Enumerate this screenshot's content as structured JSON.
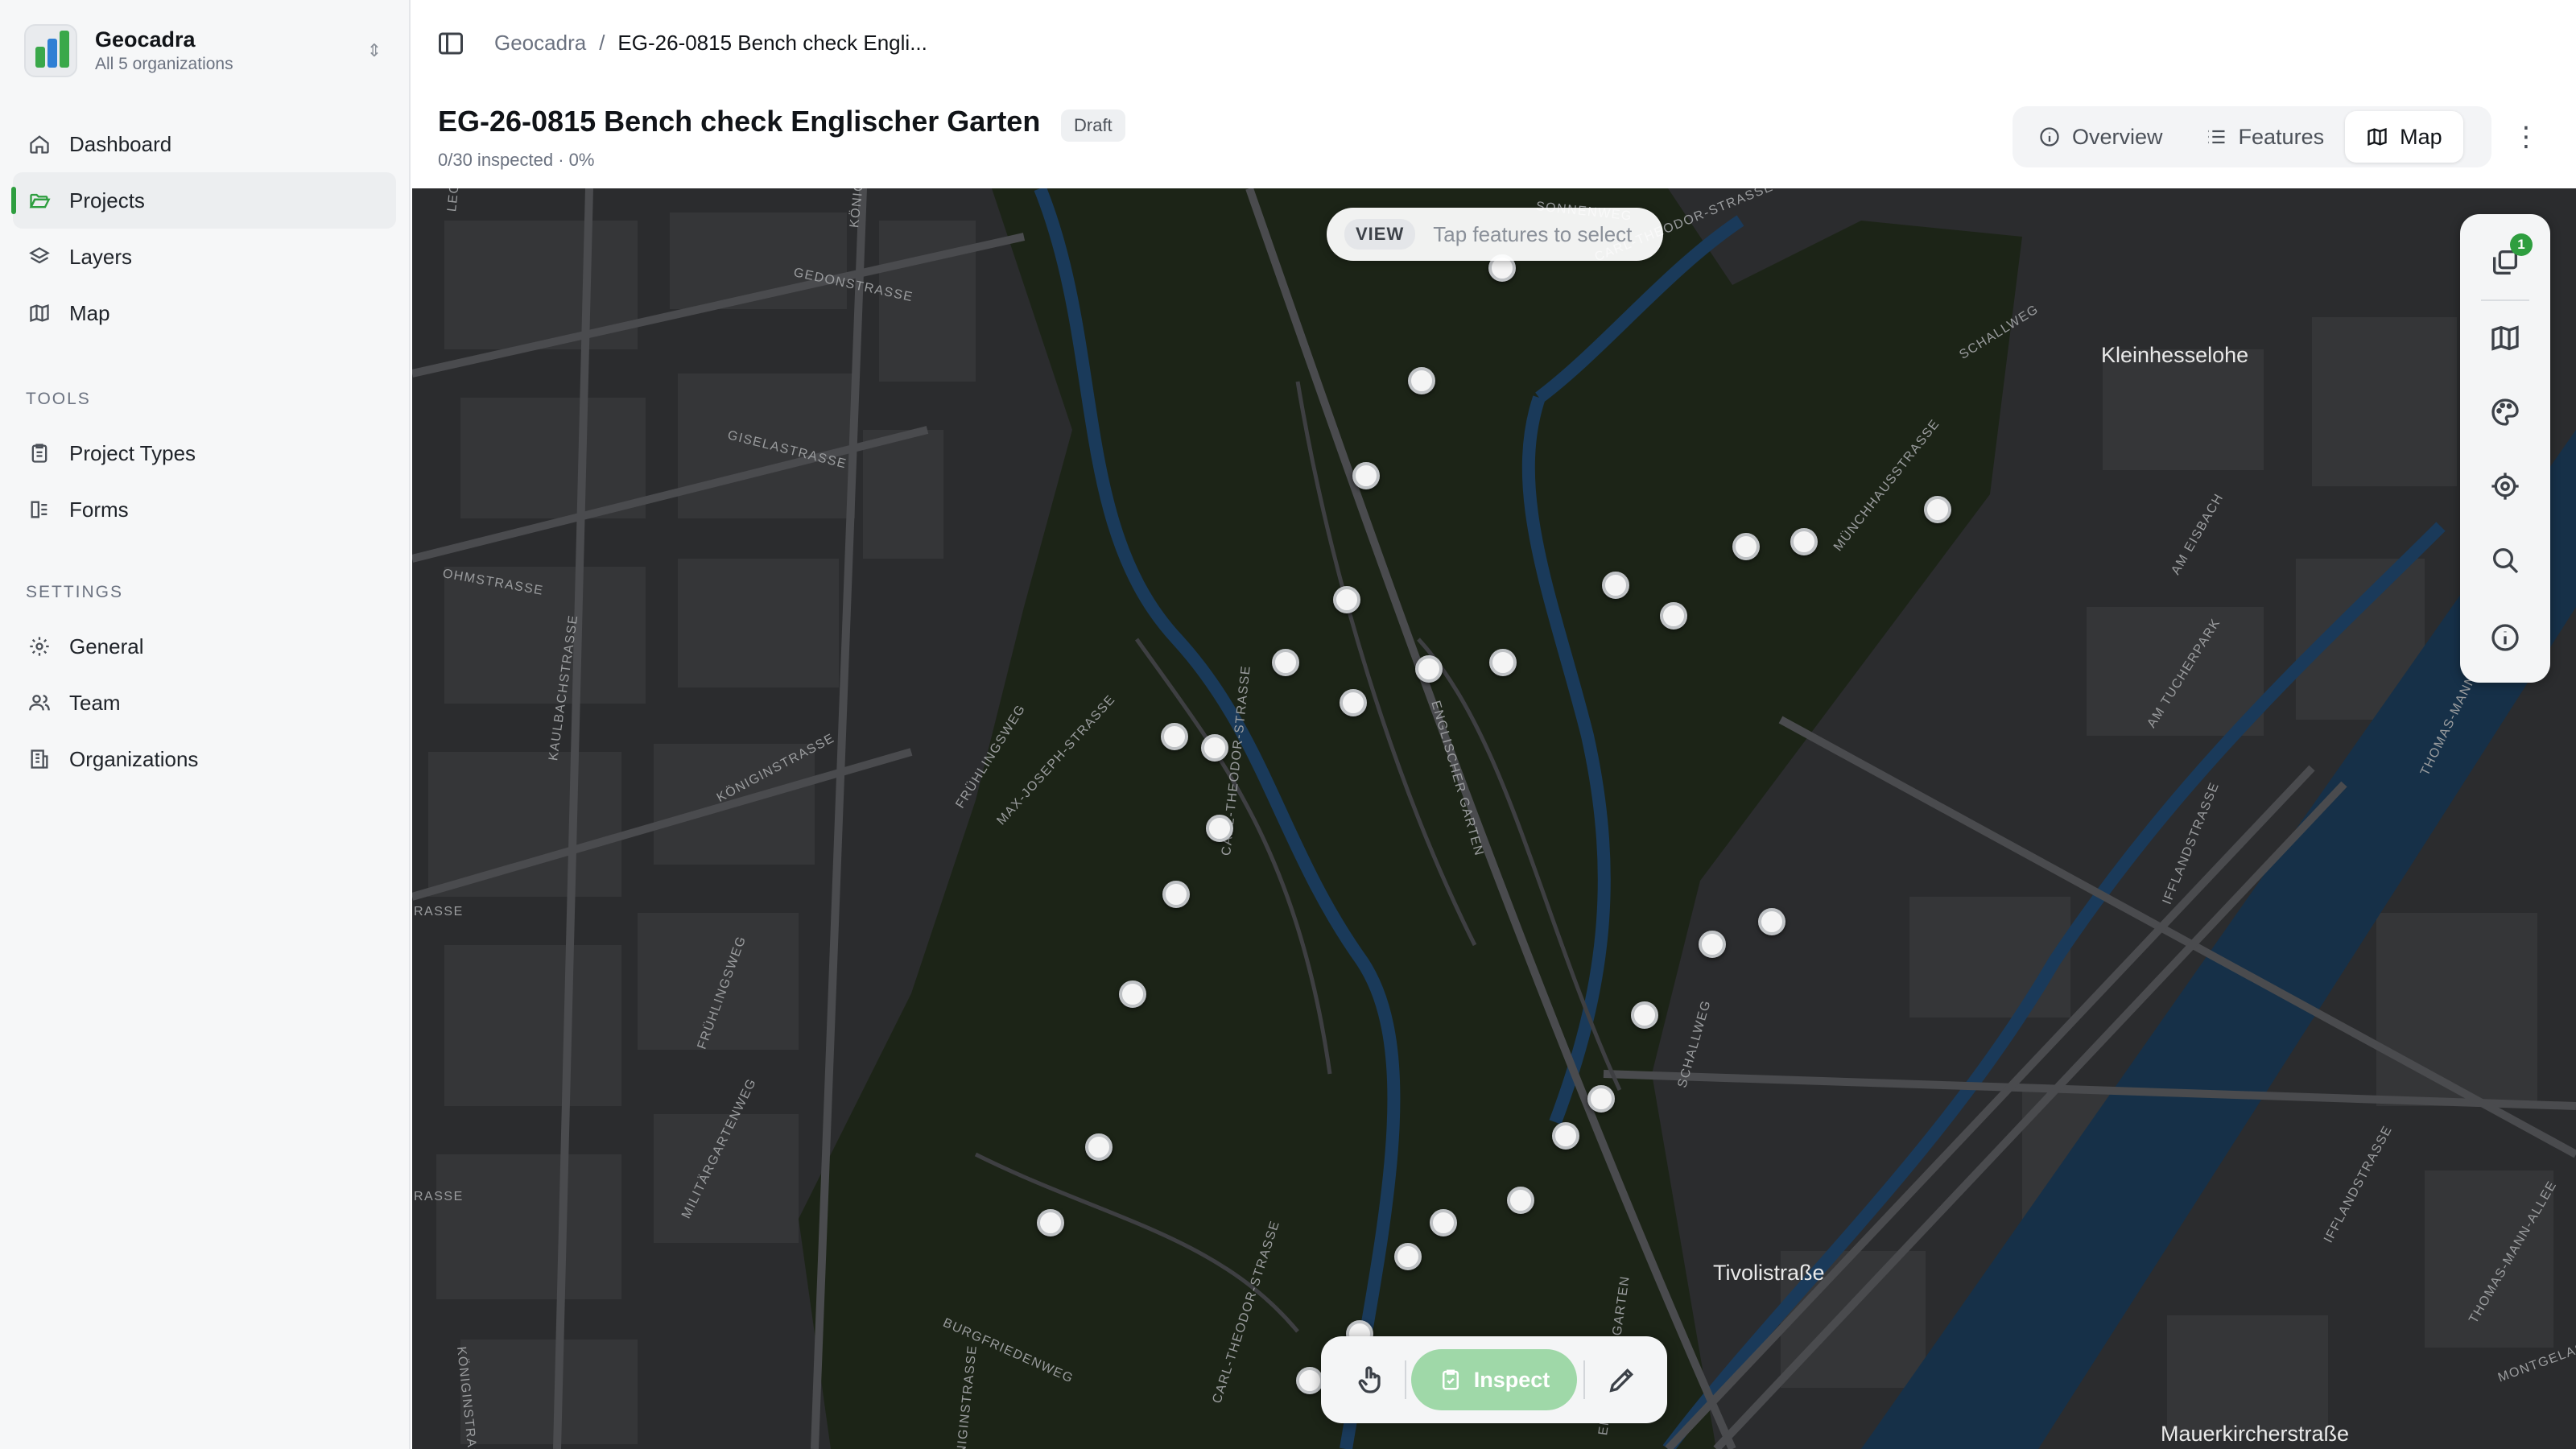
{
  "org": {
    "name": "Geocadra",
    "subtitle": "All 5 organizations"
  },
  "nav": {
    "main": [
      {
        "label": "Dashboard",
        "icon": "home-icon"
      },
      {
        "label": "Projects",
        "icon": "folder-icon",
        "active": true
      },
      {
        "label": "Layers",
        "icon": "layers-icon"
      },
      {
        "label": "Map",
        "icon": "map-icon"
      }
    ],
    "tools_heading": "TOOLS",
    "tools": [
      {
        "label": "Project Types",
        "icon": "clipboard-icon"
      },
      {
        "label": "Forms",
        "icon": "form-icon"
      }
    ],
    "settings_heading": "SETTINGS",
    "settings": [
      {
        "label": "General",
        "icon": "gear-icon"
      },
      {
        "label": "Team",
        "icon": "users-icon"
      },
      {
        "label": "Organizations",
        "icon": "building-icon"
      }
    ]
  },
  "breadcrumb": {
    "root": "Geocadra",
    "separator": "/",
    "current": "EG-26-0815 Bench check Engli..."
  },
  "project": {
    "title": "EG-26-0815 Bench check Englischer Garten",
    "status": "Draft",
    "progress": "0/30 inspected · 0%"
  },
  "view_tabs": [
    {
      "label": "Overview",
      "icon": "info-icon"
    },
    {
      "label": "Features",
      "icon": "list-icon"
    },
    {
      "label": "Map",
      "icon": "map-icon",
      "active": true
    }
  ],
  "map": {
    "mode_badge": "VIEW",
    "mode_hint": "Tap features to select",
    "layers_count": "1",
    "place_labels": [
      "Kleinhesselohe",
      "Tivolistraße",
      "Mauerkircherstraße"
    ],
    "street_labels": [
      "SONNENWEG",
      "CARL-THEODOR-STRASSE",
      "GEDONSTRASSE",
      "GISELASTRASSE",
      "OHMSTRASSE",
      "KAULBACHSTRASSE",
      "KÖNIGINSTRASSE",
      "FRÜHLINGSWEG",
      "MAX-JOSEPH-STRASSE",
      "CARL-THEODOR-STRASSE",
      "ENGLISCHER GARTEN",
      "SCHALLWEG",
      "MÜNCHHAUSSTRASSE",
      "AM EISBACH",
      "AM TUCHERPARK",
      "IFFLANDSTRASSE",
      "THOMAS-MANN-ALLEE",
      "MILITÄRGARTENWEG",
      "BURGFRIEDENWEG",
      "KÖNIGINSTRASSE",
      "FRÜHLINGSWEG",
      "CARL-THEODOR-STRASSE",
      "KÖNIGINSTRASSE",
      "RASSE",
      "RASSE",
      "IFFLANDSTRASSE",
      "THOMAS-MANN-ALLEE",
      "MONTGELAS",
      "KÖNIGINSTRASSE",
      "LEO",
      "SCHALLWEG",
      "ENGLISCHER GARTEN"
    ],
    "features_total": 30,
    "features_inspected": 0
  },
  "toolbar": {
    "inspect_label": "Inspect"
  },
  "colors": {
    "accent": "#2e9e3f",
    "inspect_button": "#9fd8a8",
    "map_background": "#2b2c2e",
    "park": "#1c2417",
    "water": "#163048"
  }
}
